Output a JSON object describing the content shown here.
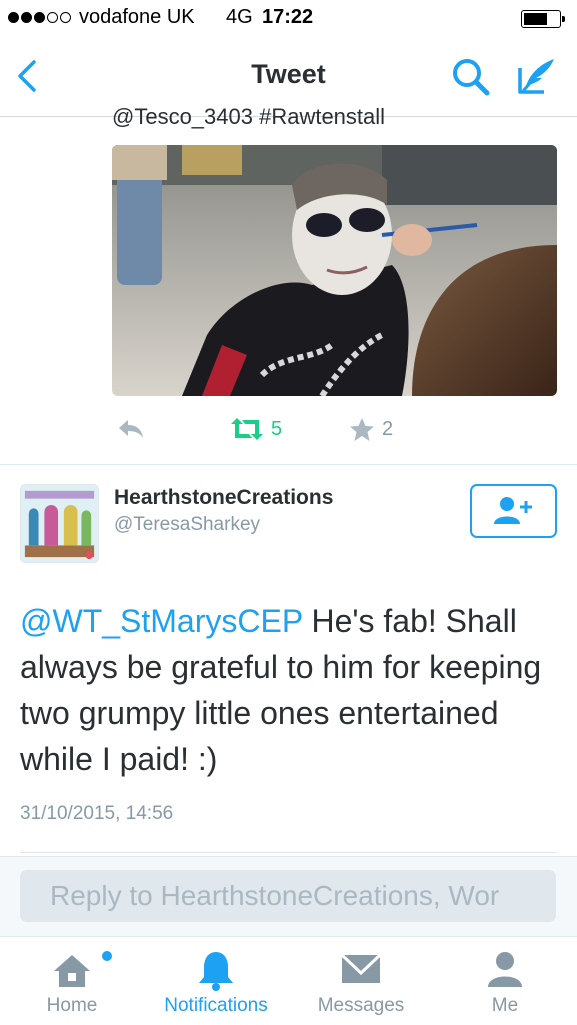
{
  "status_bar": {
    "carrier": "vodafone UK",
    "network": "4G",
    "time": "17:22",
    "signal_bars_filled": 3,
    "signal_bars_total": 5,
    "battery_level": 0.7
  },
  "nav": {
    "title": "Tweet",
    "icons": [
      "back-chevron-icon",
      "search-icon",
      "compose-icon"
    ]
  },
  "previous_tweet": {
    "cut_off_text": "@Tesco_3403 #Rawtenstall",
    "retweets": "5",
    "likes": "2"
  },
  "tweet": {
    "display_name": "HearthstoneCreations",
    "handle": "@TeresaSharkey",
    "mention": "@WT_StMarysCEP",
    "text": " He's fab! Shall always be grateful to him for keeping two grumpy little ones entertained while I paid! :)",
    "timestamp": "31/10/2015, 14:56"
  },
  "reply": {
    "placeholder": "Reply to HearthstoneCreations, Wor"
  },
  "tabs": [
    {
      "label": "Home",
      "icon": "home-icon",
      "has_badge": true
    },
    {
      "label": "Notifications",
      "icon": "bell-icon",
      "active": true
    },
    {
      "label": "Messages",
      "icon": "envelope-icon"
    },
    {
      "label": "Me",
      "icon": "person-icon"
    }
  ],
  "colors": {
    "accent": "#1da1f2",
    "retweet": "#19cf86",
    "muted": "#8899a6",
    "text": "#292f33"
  }
}
